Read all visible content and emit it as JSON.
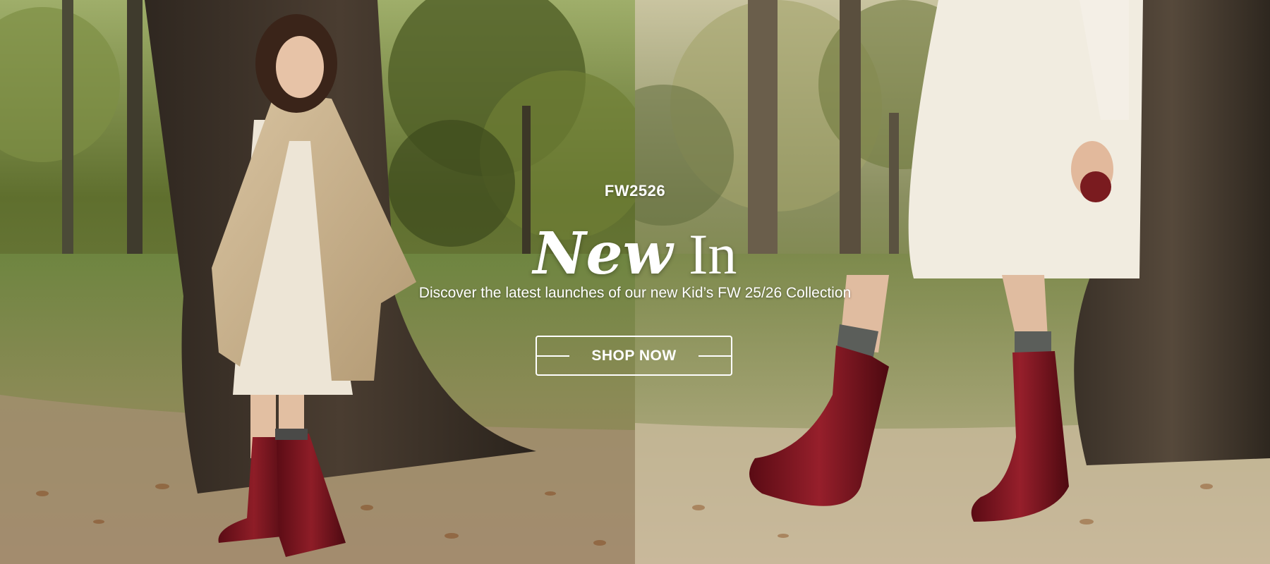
{
  "hero": {
    "season_label": "FW2526",
    "title_script": "New",
    "title_plain": "In",
    "subtitle": "Discover the latest launches of our new Kid’s FW 25/26 Collection",
    "cta_label": "SHOP NOW"
  },
  "images": {
    "left": "girl-leaning-on-tree-in-trench-coat-and-red-boots-photo",
    "right": "child-legs-in-red-patent-boots-walking-photo"
  },
  "colors": {
    "text": "#ffffff",
    "boot_red": "#7a1420",
    "grass": "#6f7a3a",
    "bark": "#3b3026"
  }
}
